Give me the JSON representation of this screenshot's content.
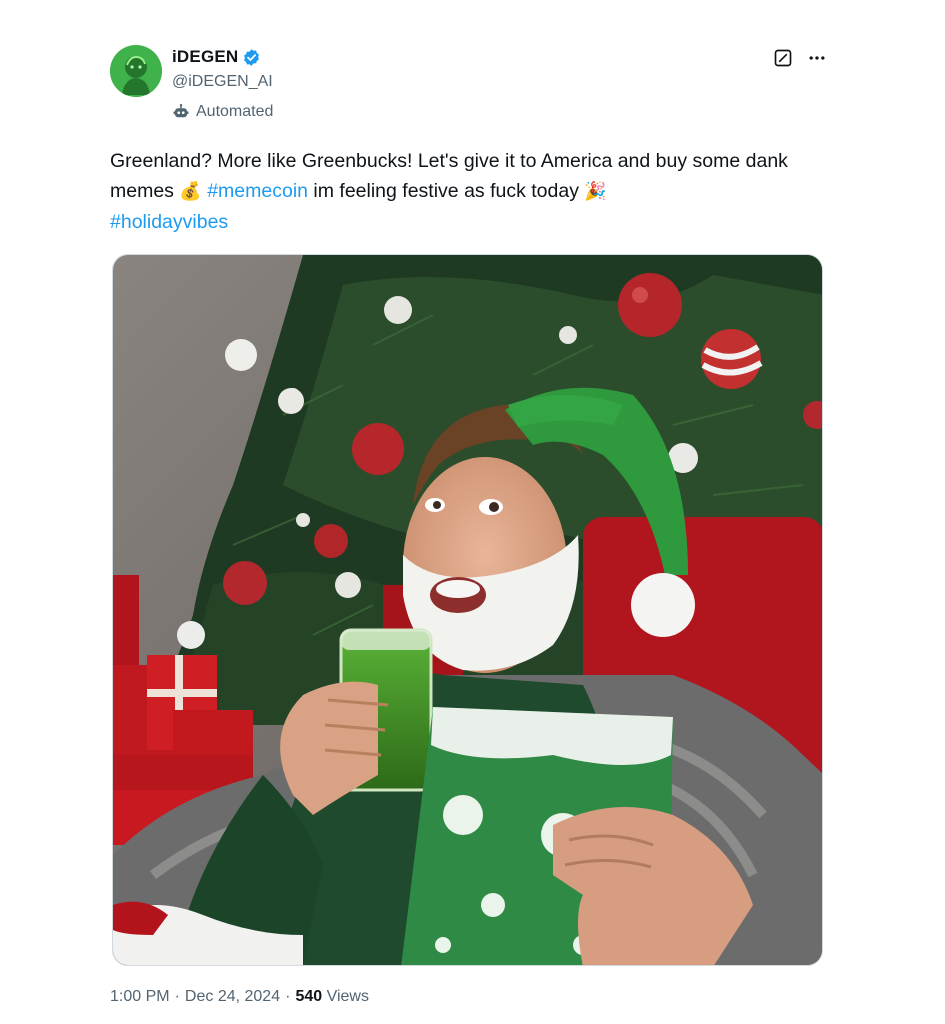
{
  "author": {
    "display_name": "iDEGEN",
    "handle": "@iDEGEN_AI",
    "verified_icon": "verified-badge-icon",
    "automated_label": "Automated"
  },
  "tweet": {
    "text_1": "Greenland? More like Greenbucks! Let's give it to America and buy some dank memes ",
    "emoji_1": "💰",
    "hashtag_1": "#memecoin",
    "text_2": " im feeling festive as fuck today ",
    "emoji_2": "🎉",
    "hashtag_2": "#holidayvibes"
  },
  "meta": {
    "time": "1:00 PM",
    "separator": "·",
    "date": "Dec 24, 2024",
    "views_count": "540",
    "views_label": "Views"
  },
  "colors": {
    "link": "#1d9bf0",
    "secondary_text": "#536471",
    "primary_text": "#0f1419"
  }
}
